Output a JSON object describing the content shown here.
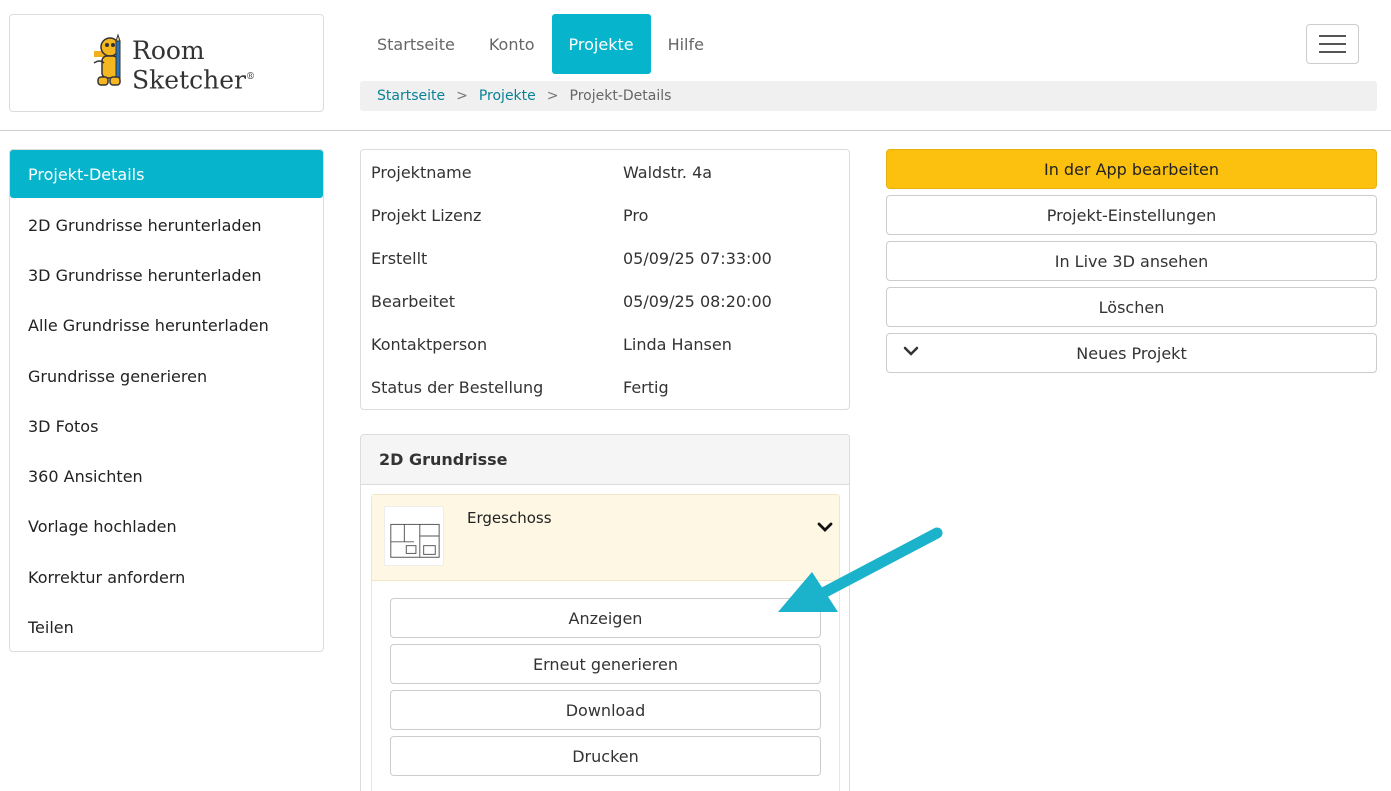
{
  "logo": {
    "line1": "Room",
    "line2": "Sketcher",
    "mark": "®"
  },
  "nav": {
    "items": [
      {
        "label": "Startseite",
        "active": false
      },
      {
        "label": "Konto",
        "active": false
      },
      {
        "label": "Projekte",
        "active": true
      },
      {
        "label": "Hilfe",
        "active": false
      }
    ]
  },
  "breadcrumb": {
    "home": "Startseite",
    "sep": ">",
    "projects": "Projekte",
    "current": "Projekt-Details"
  },
  "sidebar": {
    "items": [
      {
        "label": "Projekt-Details",
        "active": true
      },
      {
        "label": "2D Grundrisse herunterladen"
      },
      {
        "label": "3D Grundrisse herunterladen"
      },
      {
        "label": "Alle Grundrisse herunterladen"
      },
      {
        "label": "Grundrisse generieren"
      },
      {
        "label": "3D Fotos"
      },
      {
        "label": "360 Ansichten"
      },
      {
        "label": "Vorlage hochladen"
      },
      {
        "label": "Korrektur anfordern"
      },
      {
        "label": "Teilen"
      }
    ]
  },
  "details": {
    "rows": [
      {
        "key": "Projektname",
        "value": "Waldstr. 4a"
      },
      {
        "key": "Projekt Lizenz",
        "value": "Pro"
      },
      {
        "key": "Erstellt",
        "value": "05/09/25 07:33:00"
      },
      {
        "key": "Bearbeitet",
        "value": "05/09/25 08:20:00"
      },
      {
        "key": "Kontaktperson",
        "value": "Linda Hansen"
      },
      {
        "key": "Status der Bestellung",
        "value": "Fertig"
      }
    ]
  },
  "actions": {
    "edit_in_app": "In der App bearbeiten",
    "project_settings": "Projekt-Einstellungen",
    "live_3d": "In Live 3D ansehen",
    "delete": "Löschen",
    "new_project": "Neues Projekt"
  },
  "panel": {
    "title": "2D Grundrisse",
    "floor": {
      "name": "Ergeschoss",
      "buttons": {
        "view": "Anzeigen",
        "regenerate": "Erneut generieren",
        "download": "Download",
        "print": "Drucken"
      }
    }
  },
  "colors": {
    "accent": "#06b5cb",
    "primary_button": "#fcc10e",
    "link": "#0a8296",
    "arrow": "#1ab3cb"
  }
}
